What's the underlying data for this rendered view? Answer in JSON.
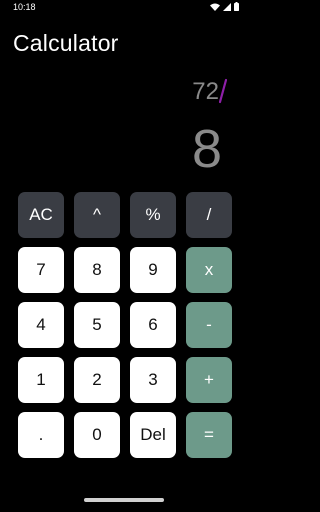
{
  "status_bar": {
    "time": "10:18"
  },
  "app": {
    "title": "Calculator"
  },
  "display": {
    "expression": "72",
    "result": "8",
    "cursor_color": "#8e1fa8"
  },
  "keys": [
    {
      "name": "all-clear-button",
      "label": "AC",
      "type": "fn"
    },
    {
      "name": "power-button",
      "label": "^",
      "type": "fn"
    },
    {
      "name": "percent-button",
      "label": "%",
      "type": "fn"
    },
    {
      "name": "divide-button",
      "label": "/",
      "type": "fn"
    },
    {
      "name": "digit-7-button",
      "label": "7",
      "type": "num"
    },
    {
      "name": "digit-8-button",
      "label": "8",
      "type": "num"
    },
    {
      "name": "digit-9-button",
      "label": "9",
      "type": "num"
    },
    {
      "name": "multiply-button",
      "label": "x",
      "type": "op"
    },
    {
      "name": "digit-4-button",
      "label": "4",
      "type": "num"
    },
    {
      "name": "digit-5-button",
      "label": "5",
      "type": "num"
    },
    {
      "name": "digit-6-button",
      "label": "6",
      "type": "num"
    },
    {
      "name": "subtract-button",
      "label": "-",
      "type": "op"
    },
    {
      "name": "digit-1-button",
      "label": "1",
      "type": "num"
    },
    {
      "name": "digit-2-button",
      "label": "2",
      "type": "num"
    },
    {
      "name": "digit-3-button",
      "label": "3",
      "type": "num"
    },
    {
      "name": "add-button",
      "label": "+",
      "type": "op"
    },
    {
      "name": "decimal-button",
      "label": ".",
      "type": "num"
    },
    {
      "name": "digit-0-button",
      "label": "0",
      "type": "num"
    },
    {
      "name": "delete-button",
      "label": "Del",
      "type": "num"
    },
    {
      "name": "equals-button",
      "label": "=",
      "type": "op"
    }
  ],
  "colors": {
    "fn_key": "#3a3d44",
    "num_key": "#ffffff",
    "op_key": "#6d9a8a",
    "display_text": "#8a8a8a"
  }
}
